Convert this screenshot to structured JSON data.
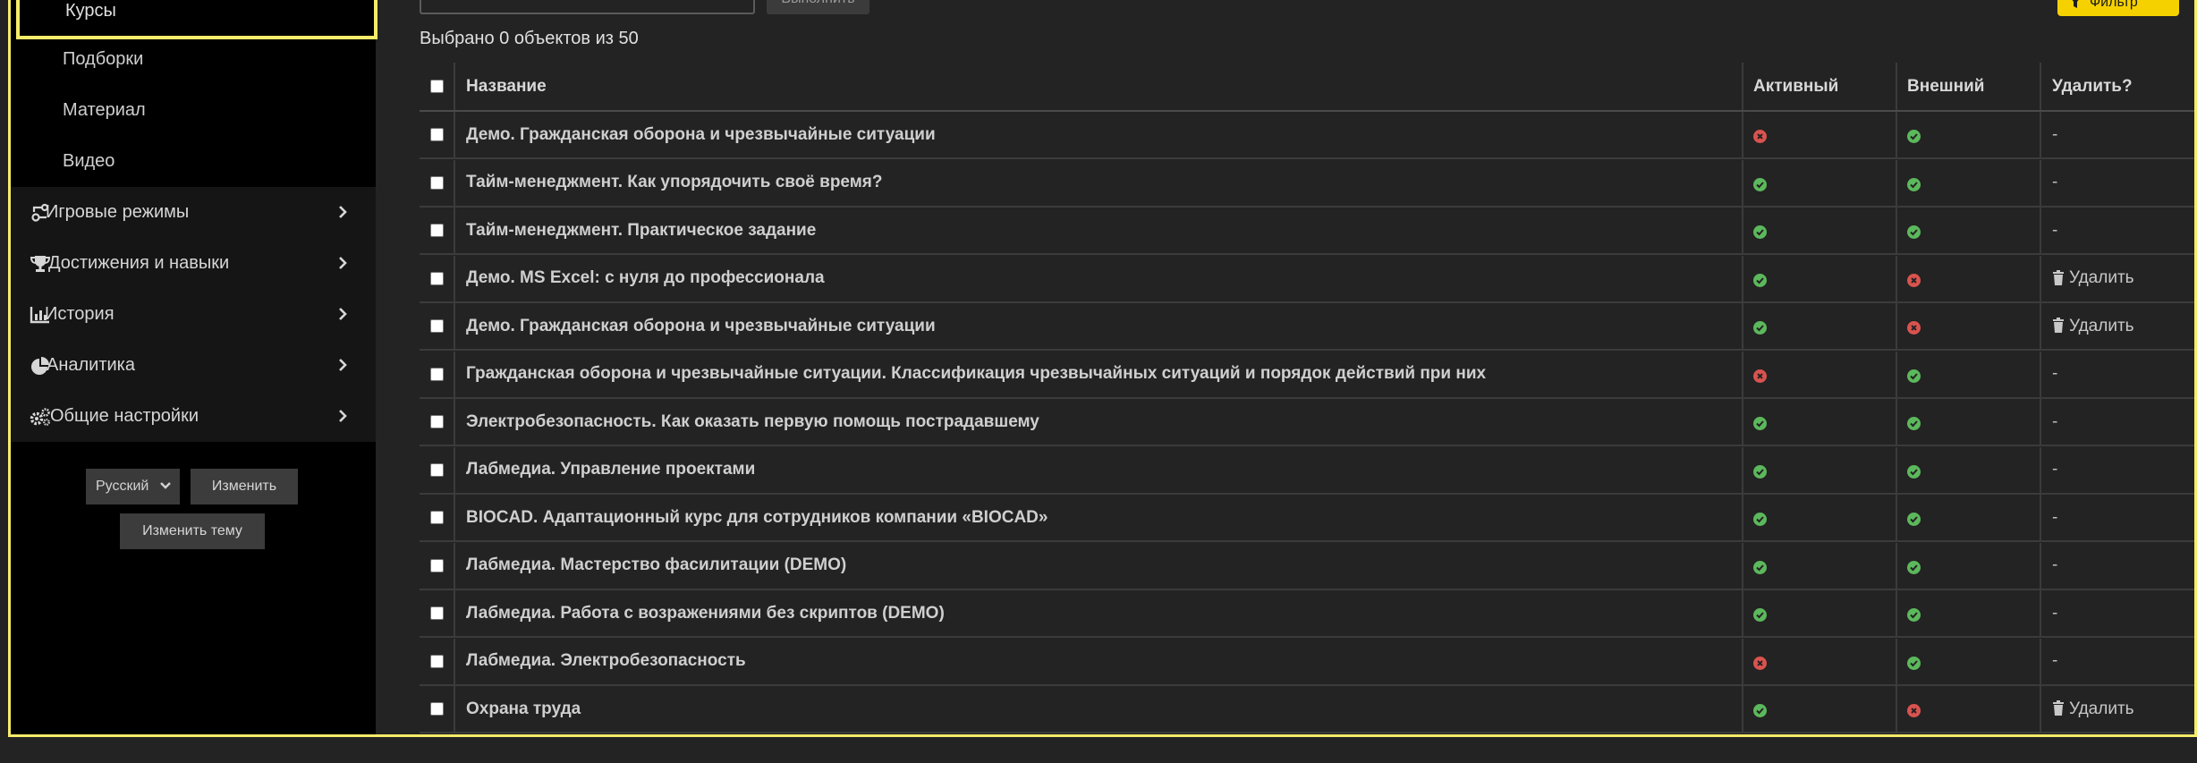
{
  "sidebar": {
    "sub_items": [
      {
        "label": "Курсы",
        "active": true
      },
      {
        "label": "Подборки"
      },
      {
        "label": "Материал"
      },
      {
        "label": "Видео"
      }
    ],
    "nav_items": [
      {
        "label": "Игровые режимы",
        "icon": "game-modes-icon"
      },
      {
        "label": "Достижения и навыки",
        "icon": "trophy-icon"
      },
      {
        "label": "История",
        "icon": "bar-chart-icon"
      },
      {
        "label": "Аналитика",
        "icon": "pie-chart-icon"
      },
      {
        "label": "Общие настройки",
        "icon": "gears-icon"
      }
    ],
    "language": "Русский",
    "change_label": "Изменить",
    "change_theme_label": "Изменить тему"
  },
  "toolbar": {
    "action_select_value": "",
    "run_label": "Выполнить",
    "filter_label": "Фильтр"
  },
  "counter": "Выбрано 0 объектов из 50",
  "table": {
    "columns": [
      "Название",
      "Активный",
      "Внешний",
      "Удалить?"
    ],
    "delete_label": "Удалить",
    "rows": [
      {
        "name": "Демо. Гражданская оборона и чрезвычайные ситуации",
        "active": false,
        "external": true,
        "delete": "-"
      },
      {
        "name": "Тайм-менеджмент. Как упорядочить своё время?",
        "active": true,
        "external": true,
        "delete": "-"
      },
      {
        "name": "Тайм-менеджмент. Практическое задание",
        "active": true,
        "external": true,
        "delete": "-"
      },
      {
        "name": "Демо. MS Excel: с нуля до профессионала",
        "active": true,
        "external": false,
        "delete": "Удалить"
      },
      {
        "name": "Демо. Гражданская оборона и чрезвычайные ситуации",
        "active": true,
        "external": false,
        "delete": "Удалить"
      },
      {
        "name": "Гражданская оборона и чрезвычайные ситуации. Классификация чрезвычайных ситуаций и порядок действий при них",
        "active": false,
        "external": true,
        "delete": "-"
      },
      {
        "name": "Электробезопасность. Как оказать первую помощь пострадавшему",
        "active": true,
        "external": true,
        "delete": "-"
      },
      {
        "name": "Лабмедиа. Управление проектами",
        "active": true,
        "external": true,
        "delete": "-"
      },
      {
        "name": "BIOCAD. Адаптационный курс для сотрудников компании «BIOCAD»",
        "active": true,
        "external": true,
        "delete": "-"
      },
      {
        "name": "Лабмедиа. Мастерство фасилитации (DEMO)",
        "active": true,
        "external": true,
        "delete": "-"
      },
      {
        "name": "Лабмедиа. Работа с возражениями без скриптов (DEMO)",
        "active": true,
        "external": true,
        "delete": "-"
      },
      {
        "name": "Лабмедиа. Электробезопасность",
        "active": false,
        "external": true,
        "delete": "-"
      },
      {
        "name": "Охрана труда",
        "active": true,
        "external": false,
        "delete": "Удалить"
      }
    ]
  },
  "colors": {
    "accent_yellow": "#f6ec6a",
    "filter_yellow": "#f5d100",
    "ok_green": "#5cb85c",
    "bad_red": "#d9534f"
  }
}
